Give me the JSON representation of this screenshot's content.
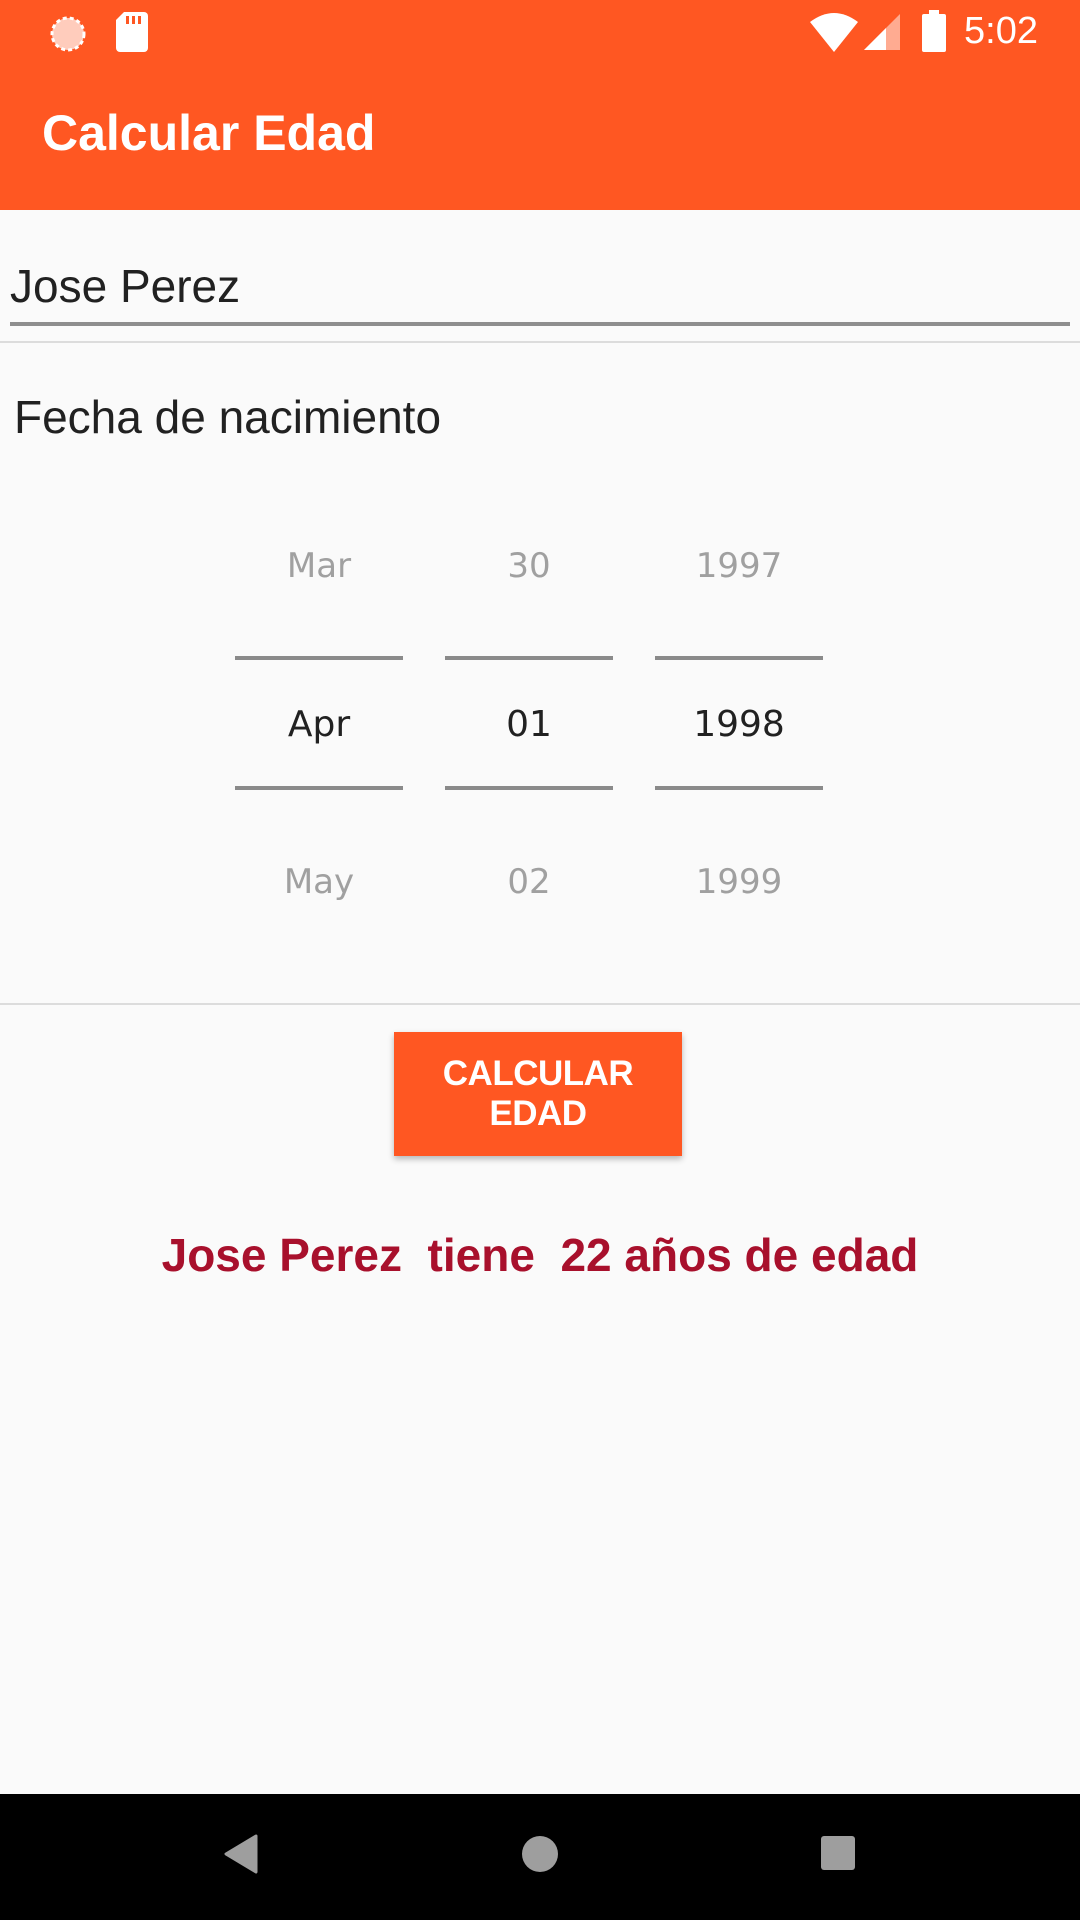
{
  "status_bar": {
    "time": "5:02",
    "icons": [
      "sync-icon",
      "sd-card-icon",
      "wifi-icon",
      "cell-signal-icon",
      "battery-icon"
    ]
  },
  "app_bar": {
    "title": "Calcular Edad"
  },
  "name_field": {
    "value": "Jose Perez"
  },
  "birthdate": {
    "label": "Fecha de nacimiento",
    "month": {
      "prev": "Mar",
      "selected": "Apr",
      "next": "May"
    },
    "day": {
      "prev": "30",
      "selected": "01",
      "next": "02"
    },
    "year": {
      "prev": "1997",
      "selected": "1998",
      "next": "1999"
    }
  },
  "calculate_button": {
    "label": "CALCULAR EDAD"
  },
  "result": {
    "text": "Jose Perez  tiene  22 años de edad"
  },
  "nav_bar": {
    "icons": [
      "back-icon",
      "home-icon",
      "recents-icon"
    ]
  },
  "colors": {
    "primary": "#ff5722",
    "result_text": "#a8102c",
    "background": "#fafafa",
    "nav_bar": "#000000"
  }
}
